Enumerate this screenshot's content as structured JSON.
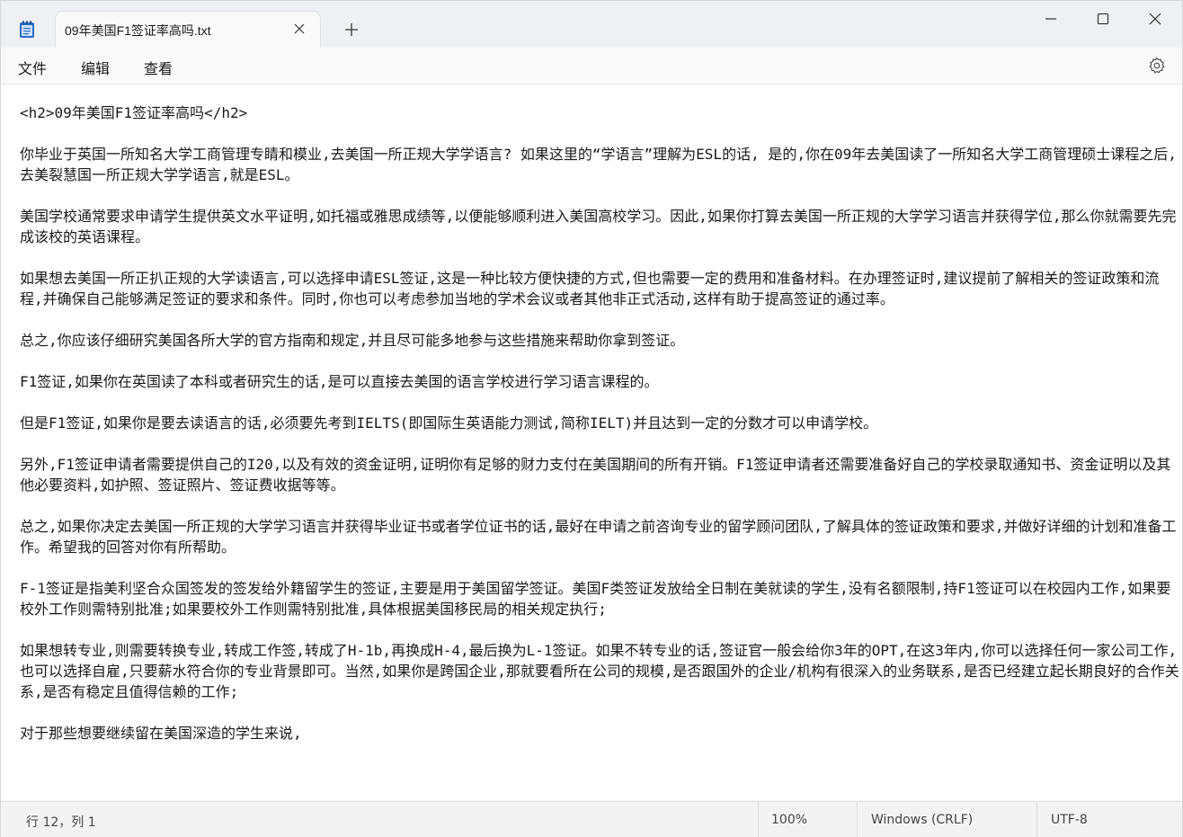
{
  "tab": {
    "title": "09年美国F1签证率高吗.txt"
  },
  "menu": {
    "file": "文件",
    "edit": "编辑",
    "view": "查看"
  },
  "content": {
    "paragraphs": [
      "<h2>09年美国F1签证率高吗</h2>",
      "你毕业于英国一所知名大学工商管理专睛和模业,去美国一所正规大学学语言? 如果这里的“学语言”理解为ESL的话, 是的,你在09年去美国读了一所知名大学工商管理硕士课程之后,去美裂慧国一所正规大学学语言,就是ESL。",
      "美国学校通常要求申请学生提供英文水平证明,如托福或雅思成绩等,以便能够顺利进入美国高校学习。因此,如果你打算去美国一所正规的大学学习语言并获得学位,那么你就需要先完成该校的英语课程。",
      "如果想去美国一所正扒正规的大学读语言,可以选择申请ESL签证,这是一种比较方便快捷的方式,但也需要一定的费用和准备材料。在办理签证时,建议提前了解相关的签证政策和流程,并确保自己能够满足签证的要求和条件。同时,你也可以考虑参加当地的学术会议或者其他非正式活动,这样有助于提高签证的通过率。",
      "总之,你应该仔细研究美国各所大学的官方指南和规定,并且尽可能多地参与这些措施来帮助你拿到签证。",
      "F1签证,如果你在英国读了本科或者研究生的话,是可以直接去美国的语言学校进行学习语言课程的。",
      "但是F1签证,如果你是要去读语言的话,必须要先考到IELTS(即国际生英语能力测试,简称IELT)并且达到一定的分数才可以申请学校。",
      "另外,F1签证申请者需要提供自己的I20,以及有效的资金证明,证明你有足够的财力支付在美国期间的所有开销。F1签证申请者还需要准备好自己的学校录取通知书、资金证明以及其他必要资料,如护照、签证照片、签证费收据等等。",
      "总之,如果你决定去美国一所正规的大学学习语言并获得毕业证书或者学位证书的话,最好在申请之前咨询专业的留学顾问团队,了解具体的签证政策和要求,并做好详细的计划和准备工作。希望我的回答对你有所帮助。",
      "F-1签证是指美利坚合众国签发的签发给外籍留学生的签证,主要是用于美国留学签证。美国F类签证发放给全日制在美就读的学生,没有名额限制,持F1签证可以在校园内工作,如果要校外工作则需特别批准;如果要校外工作则需特别批准,具体根据美国移民局的相关规定执行;",
      "如果想转专业,则需要转换专业,转成工作签,转成了H-1b,再换成H-4,最后换为L-1签证。如果不转专业的话,签证官一般会给你3年的OPT,在这3年内,你可以选择任何一家公司工作,也可以选择自雇,只要薪水符合你的专业背景即可。当然,如果你是跨国企业,那就要看所在公司的规模,是否跟国外的企业/机构有很深入的业务联系,是否已经建立起长期良好的合作关系,是否有稳定且值得信赖的工作;",
      "对于那些想要继续留在美国深造的学生来说,"
    ]
  },
  "status": {
    "position": "行 12，列 1",
    "zoom": "100%",
    "line_ending": "Windows (CRLF)",
    "encoding": "UTF-8"
  },
  "icons": {
    "app": "notepad-icon",
    "close_tab": "close-icon",
    "new_tab": "plus-icon",
    "minimize": "minimize-icon",
    "maximize": "maximize-icon",
    "close_window": "close-icon",
    "settings": "gear-icon"
  }
}
